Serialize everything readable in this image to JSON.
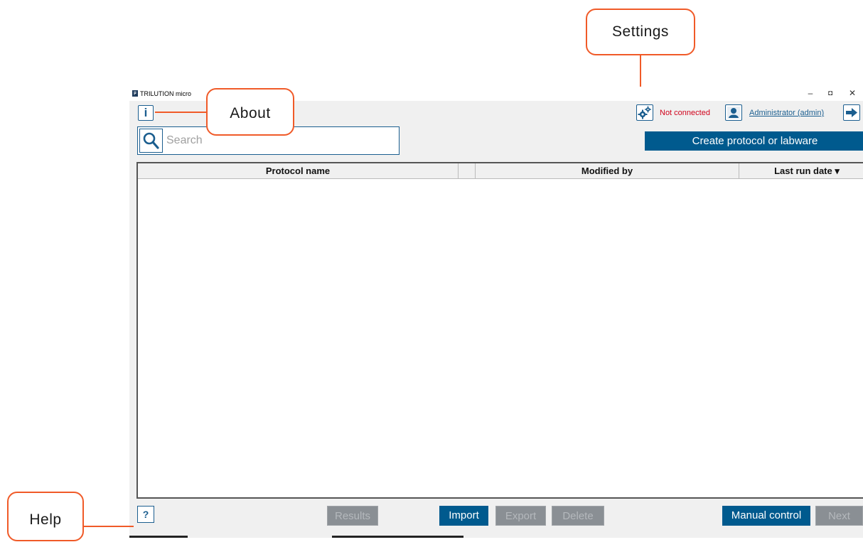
{
  "window": {
    "title": "TRILUTION micro",
    "logo_text": "µ",
    "min_glyph": "–",
    "max_glyph": "◘",
    "close_glyph": "✕"
  },
  "header": {
    "info_glyph": "i",
    "connection_status": "Not connected",
    "user_label": "Administrator (admin)",
    "status_color": "#d0021b"
  },
  "search": {
    "placeholder": "Search"
  },
  "create_button_label": "Create protocol or labware",
  "table": {
    "columns": [
      "Protocol name",
      "",
      "Modified by",
      "Last run date ▾"
    ],
    "rows": []
  },
  "footer": {
    "help_glyph": "?",
    "results_label": "Results",
    "import_label": "Import",
    "export_label": "Export",
    "delete_label": "Delete",
    "manual_control_label": "Manual control",
    "next_label": "Next"
  },
  "callouts": {
    "settings": "Settings",
    "about": "About",
    "help": "Help"
  },
  "colors": {
    "accent": "#005a8e",
    "callout": "#f05a28",
    "disabled": "#8a8f94"
  }
}
